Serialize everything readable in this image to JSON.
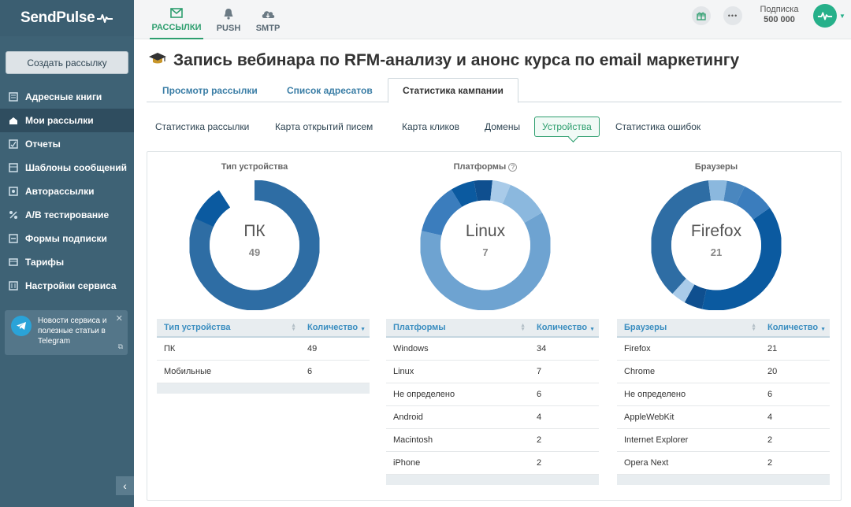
{
  "brand": {
    "logo_text": "SendPulse"
  },
  "sidebar": {
    "create_button": "Создать рассылку",
    "items": [
      {
        "label": "Адресные книги",
        "icon": "address-book-icon"
      },
      {
        "label": "Мои рассылки",
        "icon": "envelope-stack-icon",
        "active": true
      },
      {
        "label": "Отчеты",
        "icon": "report-icon"
      },
      {
        "label": "Шаблоны сообщений",
        "icon": "template-icon"
      },
      {
        "label": "Авторассылки",
        "icon": "autoresponder-icon"
      },
      {
        "label": "A/B тестирование",
        "icon": "ab-test-icon"
      },
      {
        "label": "Формы подписки",
        "icon": "form-icon"
      },
      {
        "label": "Тарифы",
        "icon": "pricing-icon"
      },
      {
        "label": "Настройки сервиса",
        "icon": "settings-icon"
      }
    ],
    "telegram": {
      "text": "Новости сервиса и полезные статьи в Telegram",
      "close": "✕"
    }
  },
  "topbar": {
    "tabs": [
      {
        "label": "РАССЫЛКИ",
        "icon": "email-icon",
        "active": true
      },
      {
        "label": "PUSH",
        "icon": "bell-icon"
      },
      {
        "label": "SMTP",
        "icon": "cloud-icon"
      }
    ],
    "subscription_label": "Подписка",
    "subscription_value": "500 000",
    "more_label": "•••"
  },
  "page": {
    "title": "Запись вебинара по RFM-анализу и анонс курса по email маркетингу",
    "tabs": [
      "Просмотр рассылки",
      "Список адресатов",
      "Статистика кампании"
    ],
    "active_tab": 2,
    "subtabs": [
      "Статистика рассылки",
      "Карта открытий писем",
      "Карта кликов",
      "Домены",
      "Устройства",
      "Статистика ошибок"
    ],
    "active_subtab": 4
  },
  "colors": {
    "accent": "#2d9e6e",
    "sidebar_bg": "#3e6275",
    "link": "#3b7ea6",
    "donut_palette": [
      "#2e6da4",
      "#0b5aa0",
      "#71a6d2",
      "#4a87bf",
      "#8bb8de",
      "#a9cbe9"
    ]
  },
  "charts": [
    {
      "title": "Тип устройства",
      "center_label": "ПК",
      "center_value": "49",
      "headers": [
        "Тип устройства",
        "Количество"
      ],
      "rows": [
        [
          "ПК",
          "49"
        ],
        [
          "Мобильные",
          "6"
        ]
      ]
    },
    {
      "title": "Платформы",
      "help_icon": "question-circle-icon",
      "center_label": "Linux",
      "center_value": "7",
      "headers": [
        "Платформы",
        "Количество"
      ],
      "rows": [
        [
          "Windows",
          "34"
        ],
        [
          "Linux",
          "7"
        ],
        [
          "Не определено",
          "6"
        ],
        [
          "Android",
          "4"
        ],
        [
          "Macintosh",
          "2"
        ],
        [
          "iPhone",
          "2"
        ]
      ]
    },
    {
      "title": "Браузеры",
      "center_label": "Firefox",
      "center_value": "21",
      "headers": [
        "Браузеры",
        "Количество"
      ],
      "rows": [
        [
          "Firefox",
          "21"
        ],
        [
          "Chrome",
          "20"
        ],
        [
          "Не определено",
          "6"
        ],
        [
          "AppleWebKit",
          "4"
        ],
        [
          "Internet Explorer",
          "2"
        ],
        [
          "Opera Next",
          "2"
        ]
      ]
    }
  ]
}
